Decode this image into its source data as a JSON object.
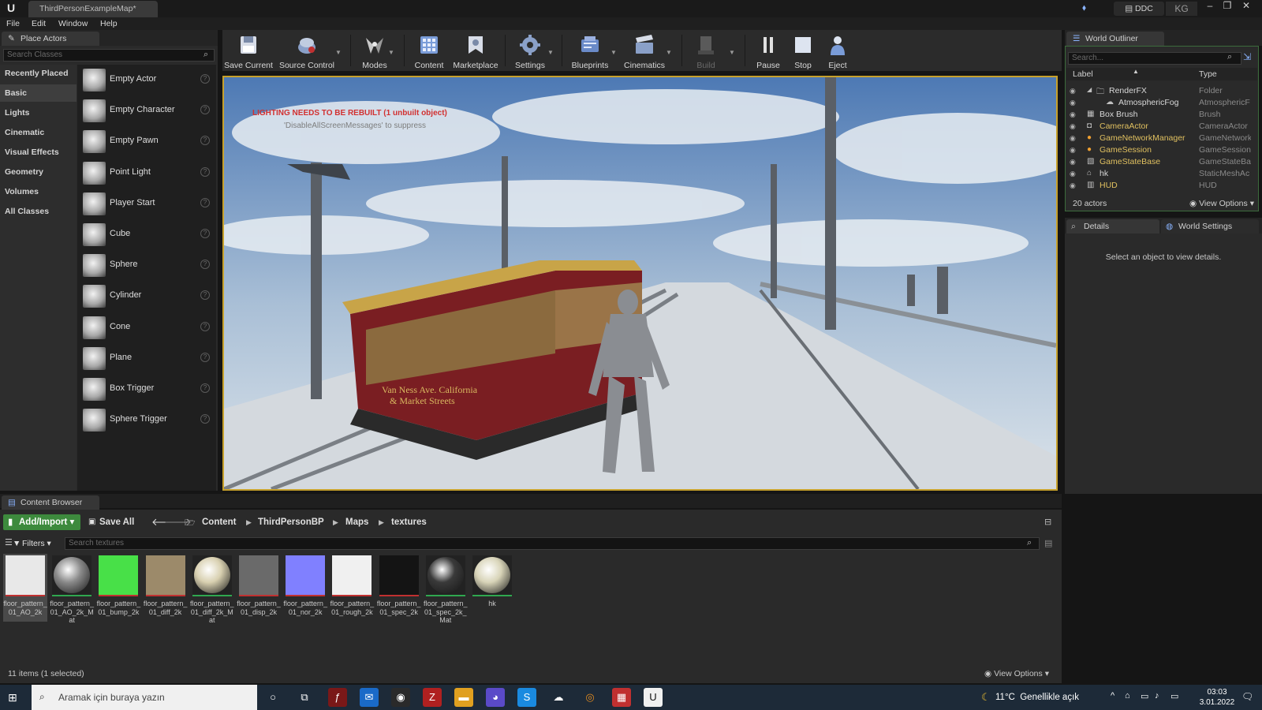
{
  "window": {
    "map_tab": "ThirdPersonExampleMap*",
    "ddc_label": "DDC",
    "user_initials": "KG"
  },
  "menu": {
    "items": [
      "File",
      "Edit",
      "Window",
      "Help"
    ]
  },
  "place_actors": {
    "tab_title": "Place Actors",
    "search_placeholder": "Search Classes",
    "categories": [
      "Recently Placed",
      "Basic",
      "Lights",
      "Cinematic",
      "Visual Effects",
      "Geometry",
      "Volumes",
      "All Classes"
    ],
    "selected_category": "Basic",
    "actors": [
      "Empty Actor",
      "Empty Character",
      "Empty Pawn",
      "Point Light",
      "Player Start",
      "Cube",
      "Sphere",
      "Cylinder",
      "Cone",
      "Plane",
      "Box Trigger",
      "Sphere Trigger"
    ]
  },
  "toolbar": {
    "save_current": "Save Current",
    "source_control": "Source Control",
    "modes": "Modes",
    "content": "Content",
    "marketplace": "Marketplace",
    "settings": "Settings",
    "blueprints": "Blueprints",
    "cinematics": "Cinematics",
    "build": "Build",
    "pause": "Pause",
    "stop": "Stop",
    "eject": "Eject"
  },
  "viewport": {
    "warning": "LIGHTING NEEDS TO BE REBUILT (1 unbuilt object)",
    "hint": "'DisableAllScreenMessages' to suppress",
    "tram_sign_line1": "Van Ness Ave. California",
    "tram_sign_line2": "& Market Streets"
  },
  "outliner": {
    "tab_title": "World Outliner",
    "search_placeholder": "Search...",
    "col_label": "Label",
    "col_type": "Type",
    "rows": [
      {
        "label": "RenderFX",
        "type": "Folder",
        "highlight": false,
        "indent": 1,
        "icon": "folder-icon"
      },
      {
        "label": "AtmosphericFog",
        "type": "AtmosphericF",
        "highlight": false,
        "indent": 2,
        "icon": "fog-icon"
      },
      {
        "label": "Box Brush",
        "type": "Brush",
        "highlight": false,
        "indent": 0,
        "icon": "brush-icon"
      },
      {
        "label": "CameraActor",
        "type": "CameraActor",
        "highlight": true,
        "indent": 0,
        "icon": "camera-icon"
      },
      {
        "label": "GameNetworkManager",
        "type": "GameNetwork",
        "highlight": true,
        "indent": 0,
        "icon": "actor-icon"
      },
      {
        "label": "GameSession",
        "type": "GameSession",
        "highlight": true,
        "indent": 0,
        "icon": "actor-icon"
      },
      {
        "label": "GameStateBase",
        "type": "GameStateBa",
        "highlight": true,
        "indent": 0,
        "icon": "state-icon"
      },
      {
        "label": "hk",
        "type": "StaticMeshAc",
        "highlight": false,
        "indent": 0,
        "icon": "mesh-icon"
      },
      {
        "label": "HUD",
        "type": "HUD",
        "highlight": true,
        "indent": 0,
        "icon": "hud-icon"
      }
    ],
    "actor_count": "20 actors",
    "view_options": "View Options"
  },
  "details": {
    "tab_title": "Details",
    "world_settings_tab": "World Settings",
    "empty_message": "Select an object to view details."
  },
  "content_browser": {
    "tab_title": "Content Browser",
    "add_import": "Add/Import",
    "save_all": "Save All",
    "breadcrumbs": [
      "Content",
      "ThirdPersonBP",
      "Maps",
      "textures"
    ],
    "filters_label": "Filters",
    "search_placeholder": "Search textures",
    "assets": [
      {
        "label": "floor_pattern_01_AO_2k",
        "color": "#e8e8e8",
        "bar": "#c03030",
        "kind": "flat",
        "selected": true
      },
      {
        "label": "floor_pattern_01_AO_2k_Mat",
        "color": "#8a8a8a",
        "bar": "#2fa84f",
        "kind": "sphere",
        "selected": false
      },
      {
        "label": "floor_pattern_01_bump_2k",
        "color": "#48e048",
        "bar": "#c03030",
        "kind": "flat",
        "selected": false
      },
      {
        "label": "floor_pattern_01_diff_2k",
        "color": "#9c8a6a",
        "bar": "#c03030",
        "kind": "flat",
        "selected": false
      },
      {
        "label": "floor_pattern_01_diff_2k_Mat",
        "color": "#d8d0b0",
        "bar": "#2fa84f",
        "kind": "sphere",
        "selected": false
      },
      {
        "label": "floor_pattern_01_disp_2k",
        "color": "#6a6a6a",
        "bar": "#c03030",
        "kind": "flat",
        "selected": false
      },
      {
        "label": "floor_pattern_01_nor_2k",
        "color": "#8080ff",
        "bar": "#c03030",
        "kind": "flat",
        "selected": false
      },
      {
        "label": "floor_pattern_01_rough_2k",
        "color": "#f0f0f0",
        "bar": "#c03030",
        "kind": "flat",
        "selected": false
      },
      {
        "label": "floor_pattern_01_spec_2k",
        "color": "#141414",
        "bar": "#c03030",
        "kind": "flat",
        "selected": false
      },
      {
        "label": "floor_pattern_01_spec_2k_Mat",
        "color": "#3a3a3a",
        "bar": "#2fa84f",
        "kind": "sphere",
        "selected": false
      },
      {
        "label": "hk",
        "color": "#d8d4b8",
        "bar": "#2fa84f",
        "kind": "sphere",
        "selected": false
      }
    ],
    "item_count": "11 items (1 selected)",
    "view_options": "View Options"
  },
  "taskbar": {
    "search_placeholder": "Aramak için buraya yazın",
    "weather_temp": "11°C",
    "weather_desc": "Genellikle açık",
    "time": "03:03",
    "date": "3.01.2022"
  }
}
